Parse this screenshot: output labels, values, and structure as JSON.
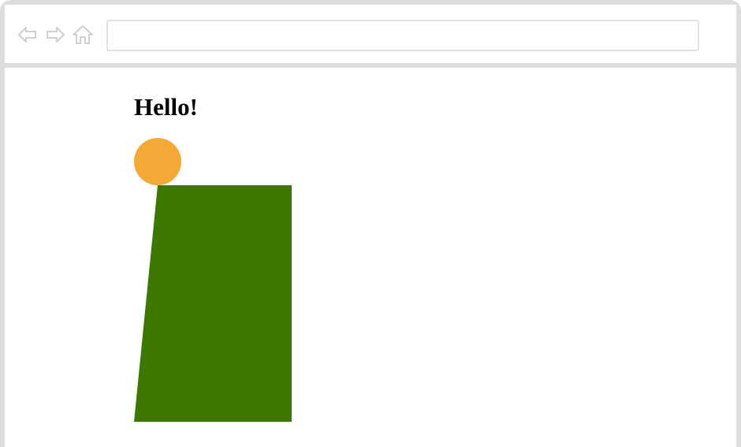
{
  "browser": {
    "address_value": "",
    "icons": {
      "back": "arrow-left-icon",
      "forward": "arrow-right-icon",
      "home": "home-icon"
    },
    "chrome_color": "#dddddd"
  },
  "page": {
    "heading": "Hello!",
    "colors": {
      "circle": "#f4a937",
      "shape": "#3d7700"
    }
  }
}
